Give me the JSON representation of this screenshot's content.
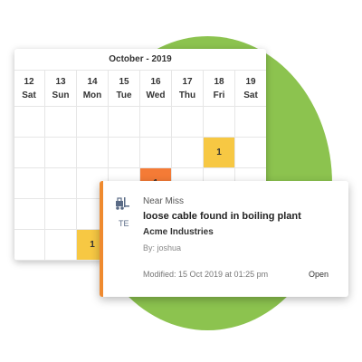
{
  "calendar": {
    "title": "October - 2019",
    "days": [
      {
        "num": "12",
        "name": "Sat"
      },
      {
        "num": "13",
        "name": "Sun"
      },
      {
        "num": "14",
        "name": "Mon"
      },
      {
        "num": "15",
        "name": "Tue"
      },
      {
        "num": "16",
        "name": "Wed"
      },
      {
        "num": "17",
        "name": "Thu"
      },
      {
        "num": "18",
        "name": "Fri"
      },
      {
        "num": "19",
        "name": "Sat"
      }
    ],
    "events": [
      {
        "row": 1,
        "col": 6,
        "count": "1",
        "color": "#f7c843"
      },
      {
        "row": 2,
        "col": 4,
        "count": "1",
        "color": "#f47b36"
      },
      {
        "row": 4,
        "col": 2,
        "count": "1",
        "color": "#f7c843"
      }
    ],
    "rows": 5
  },
  "card": {
    "type": "Near Miss",
    "title": "loose cable found in boiling plant",
    "company": "Acme Industries",
    "by": "By: joshua",
    "badge": "TE",
    "modified": "Modified: 15 Oct 2019 at 01:25 pm",
    "open_label": "Open",
    "accent_color": "#ef8a2f",
    "icon": "forklift-icon"
  },
  "colors": {
    "background_circle": "#8cc34f"
  }
}
